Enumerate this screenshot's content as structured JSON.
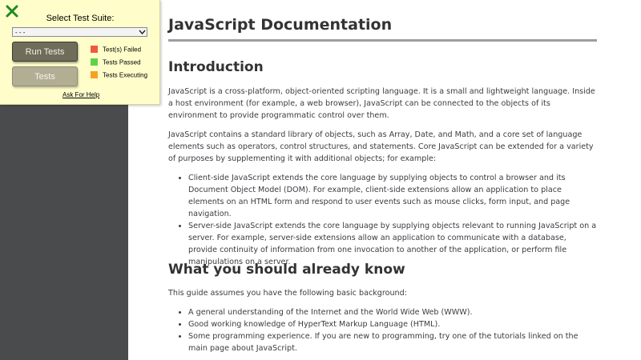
{
  "test_panel": {
    "suite_label": "Select Test Suite:",
    "suite_selected": "- - -",
    "run_button": "Run Tests",
    "tests_button": "Tests",
    "legend": [
      {
        "label": "Test(s) Failed",
        "color": "#f05a3c"
      },
      {
        "label": "Tests Passed",
        "color": "#5fd24a"
      },
      {
        "label": "Tests Executing",
        "color": "#f4a223"
      }
    ],
    "help_link": "Ask For Help",
    "close_icon": "close-x-icon",
    "close_color": "#1f8a1f"
  },
  "doc": {
    "title": "JavaScript Documentation",
    "intro": {
      "heading": "Introduction",
      "p1": "JavaScript is a cross-platform, object-oriented scripting language. It is a small and lightweight language. Inside a host environment (for example, a web browser), JavaScript can be connected to the objects of its environment to provide programmatic control over them.",
      "p2": "JavaScript contains a standard library of objects, such as Array, Date, and Math, and a core set of language elements such as operators, control structures, and statements. Core JavaScript can be extended for a variety of purposes by supplementing it with additional objects; for example:",
      "bullets": [
        "Client-side JavaScript extends the core language by supplying objects to control a browser and its Document Object Model (DOM). For example, client-side extensions allow an application to place elements on an HTML form and respond to user events such as mouse clicks, form input, and page navigation.",
        "Server-side JavaScript extends the core language by supplying objects relevant to running JavaScript on a server. For example, server-side extensions allow an application to communicate with a database, provide continuity of information from one invocation to another of the application, or perform file manipulations on a server."
      ]
    },
    "know": {
      "heading": "What you should already know",
      "p1": "This guide assumes you have the following basic background:",
      "bullets": [
        "A general understanding of the Internet and the World Wide Web (WWW).",
        "Good working knowledge of HyperText Markup Language (HTML).",
        "Some programming experience. If you are new to programming, try one of the tutorials linked on the main page about JavaScript."
      ]
    }
  }
}
